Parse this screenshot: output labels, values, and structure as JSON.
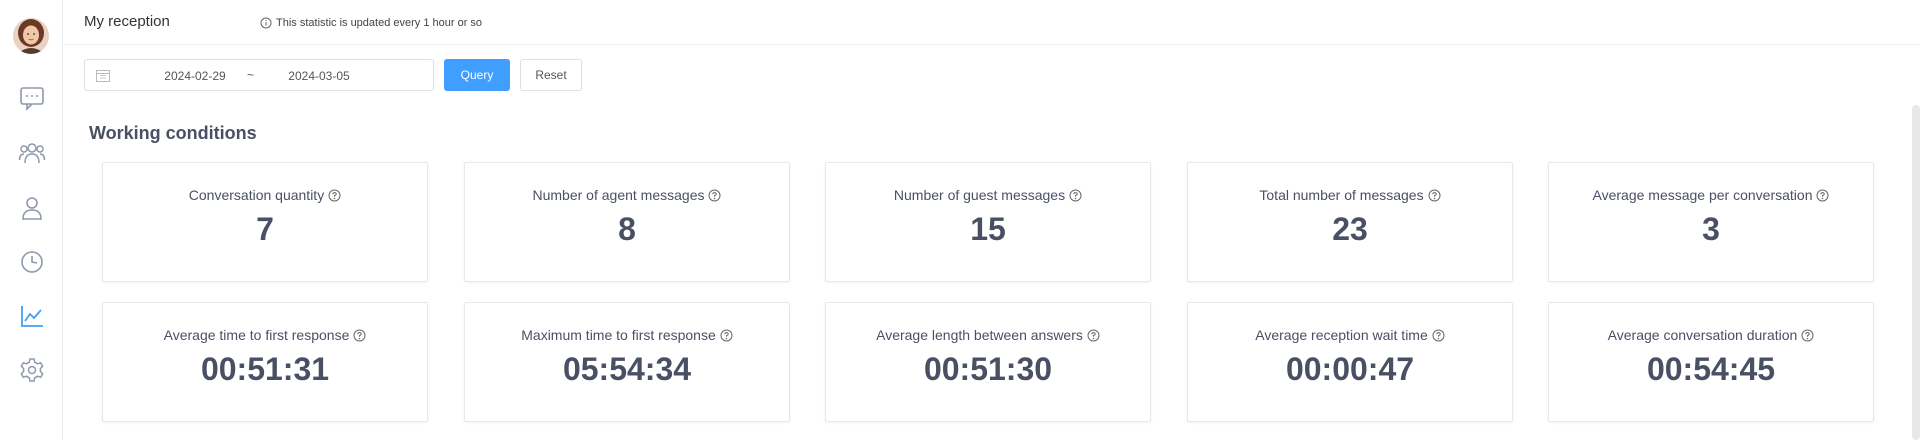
{
  "header": {
    "title": "My reception",
    "note": "This statistic is updated every 1 hour or so"
  },
  "filter": {
    "date_start": "2024-02-29",
    "separator": "~",
    "date_end": "2024-03-05",
    "query_label": "Query",
    "reset_label": "Reset"
  },
  "section": {
    "title": "Working conditions"
  },
  "sidebar": {
    "items": [
      {
        "icon": "chat-icon",
        "active": false
      },
      {
        "icon": "group-icon",
        "active": false
      },
      {
        "icon": "user-icon",
        "active": false
      },
      {
        "icon": "clock-icon",
        "active": false
      },
      {
        "icon": "line-chart-icon",
        "active": true
      },
      {
        "icon": "gear-icon",
        "active": false
      }
    ]
  },
  "stats": [
    {
      "label": "Conversation quantity",
      "value": "7"
    },
    {
      "label": "Number of agent messages",
      "value": "8"
    },
    {
      "label": "Number of guest messages",
      "value": "15"
    },
    {
      "label": "Total number of messages",
      "value": "23"
    },
    {
      "label": "Average message per conversation",
      "value": "3"
    },
    {
      "label": "Average time to first response",
      "value": "00:51:31"
    },
    {
      "label": "Maximum time to first response",
      "value": "05:54:34"
    },
    {
      "label": "Average length between answers",
      "value": "00:51:30"
    },
    {
      "label": "Average reception wait time",
      "value": "00:00:47"
    },
    {
      "label": "Average conversation duration",
      "value": "00:54:45"
    }
  ],
  "colors": {
    "accent": "#409eff",
    "text": "#4a5064",
    "icon": "#8e99ad",
    "active_icon": "#409eff"
  }
}
